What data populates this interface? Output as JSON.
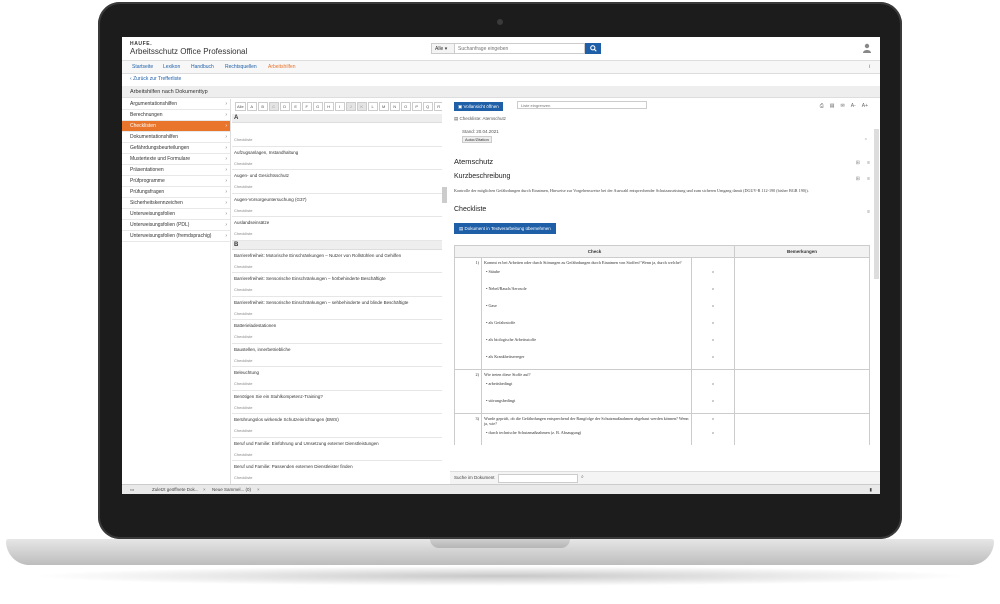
{
  "header": {
    "brand_small": "HAUFE.",
    "app_title": "Arbeitsschutz Office Professional",
    "search_scope": "Alle",
    "search_placeholder": "Suchanfrage eingeben",
    "user_icon": "user-icon"
  },
  "nav": {
    "tabs": [
      "Startseite",
      "Lexikon",
      "Handbuch",
      "Rechtsquellen",
      "Arbeitshilfen"
    ],
    "active": "Arbeitshilfen",
    "info": "i"
  },
  "back_link": "Zurück zur Trefferliste",
  "section_title": "Arbeitshilfen nach Dokumenttyp",
  "sidebar": {
    "items": [
      "Argumentationshilfen",
      "Berechnungen",
      "Checklisten",
      "Dokumentationshilfen",
      "Gefährdungsbeurteilungen",
      "Mustertexte und Formulare",
      "Präsentationen",
      "Prüfprogramme",
      "Prüfungsfragen",
      "Sicherheitskennzeichen",
      "Unterweisungsfolien",
      "Unterweisungsfolien (PDL)",
      "Unterweisungsfolien (fremdsprachig)"
    ],
    "active": "Checklisten"
  },
  "alphabet": {
    "all": "Alle",
    "letters": [
      "A",
      "B",
      "C",
      "D",
      "E",
      "F",
      "G",
      "H",
      "I",
      "J",
      "K",
      "L",
      "M",
      "N",
      "O",
      "P",
      "Q",
      "R",
      "S",
      "T",
      "U",
      "V",
      "W",
      "X",
      "Y",
      "Z"
    ],
    "disabled": [
      "C",
      "J",
      "K",
      "Y",
      "Z"
    ],
    "filter_placeholder": "Liste eingrenzen"
  },
  "list": {
    "group_a": "A",
    "entries_a": [
      {
        "title": "",
        "sub": "Checkliste"
      },
      {
        "title": "Aufzugsanlagen, Instandhaltung",
        "sub": "Checkliste"
      },
      {
        "title": "Augen- und Gesichtsschutz",
        "sub": "Checkliste"
      },
      {
        "title": "Augen-Vorsorgeuntersuchung (G37)",
        "sub": "Checkliste"
      },
      {
        "title": "Auslandseinsätze",
        "sub": "Checkliste"
      }
    ],
    "group_b": "B",
    "entries_b": [
      {
        "title": "Barrierefreiheit: Motorische Einschränkungen – Nutzer von Rollstühlen und Gehilfen",
        "sub": "Checkliste"
      },
      {
        "title": "Barrierefreiheit: Sensorische Einschränkungen – hörbehinderte Beschäftigte",
        "sub": "Checkliste"
      },
      {
        "title": "Barrierefreiheit: Sensorische Einschränkungen – sehbehinderte und blinde Beschäftigte",
        "sub": "Checkliste"
      },
      {
        "title": "Batterieladestationen",
        "sub": "Checkliste"
      },
      {
        "title": "Baustellen, innerbetriebliche",
        "sub": "Checkliste"
      },
      {
        "title": "Beleuchtung",
        "sub": "Checkliste"
      },
      {
        "title": "Benötigen Sie ein Stuhlkompetenz-Training?",
        "sub": "Checkliste"
      },
      {
        "title": "Berührungslos wirkende Schutzeinrichtungen (BWS)",
        "sub": "Checkliste"
      },
      {
        "title": "Beruf und Familie: Einführung und Umsetzung externer Dienstleistungen",
        "sub": "Checkliste"
      },
      {
        "title": "Beruf und Familie: Passenden externen Dienstleister finden",
        "sub": "Checkliste"
      },
      {
        "title": "Beruf und Familie: Vereinbarkeit im Unternehmen",
        "sub": ""
      }
    ]
  },
  "doc": {
    "full_view": "Vollansicht öffnen",
    "crumb": "Checkliste: Atemschutz",
    "stand": "Stand: 20.04.2021",
    "zitation": "Autor/Zitation",
    "title": "Atemschutz",
    "kurz_heading": "Kurzbeschreibung",
    "kurz_text": "Kontrolle der möglichen Gefährdungen durch Einatmen, Hinweise zur Vorgehensweise bei der Auswahl entsprechender Schutzausrüstung und zum sicheren Umgang damit (DGUV-R 112-190 (bisher BGR 190)).",
    "checkliste_heading": "Checkliste",
    "text_button": "Dokument in Textverarbeitung übernehmen",
    "table": {
      "col_check": "Check",
      "col_bem": "Bemerkungen",
      "rows": [
        {
          "num": "1)",
          "text": "Kommt es bei Arbeiten oder durch Störungen zu Gefährdungen durch Einatmen von Stoffen? Wenn ja, durch welche?",
          "box": "",
          "sub": [
            {
              "text": "• Stäube",
              "box": "o"
            },
            {
              "text": "• Nebel/Rauch/Aerosole",
              "box": "o"
            },
            {
              "text": "• Gase",
              "box": "o"
            },
            {
              "text": "• als Gefahrstoffe",
              "box": "o"
            },
            {
              "text": "• als biologische Arbeitsstoffe",
              "box": "o"
            },
            {
              "text": "• als Krankheitserreger",
              "box": "o"
            }
          ]
        },
        {
          "num": "2)",
          "text": "Wie treten diese Stoffe auf?",
          "box": "",
          "sub": [
            {
              "text": "• arbeitsbedingt",
              "box": "o"
            },
            {
              "text": "• störungsbedingt",
              "box": "o"
            }
          ]
        },
        {
          "num": "3)",
          "text": "Wurde geprüft, ob die Gefährdungen entsprechend der Rangfolge der Schutzmaßnahmen abgebaut werden können? Wenn ja, wie?",
          "box": "o",
          "sub": [
            {
              "text": "• durch technische Schutzmaßnahmen (z. B. Absaugung)",
              "box": "o"
            }
          ]
        }
      ]
    },
    "search_label": "Suche im Dokument",
    "tools": [
      "print-icon",
      "save-icon",
      "mail-icon",
      "font-decrease-icon",
      "font-increase-icon"
    ],
    "font_small": "A-",
    "font_large": "A+"
  },
  "footer": {
    "tabs": [
      "Zuletzt geöffnete Dok...",
      "Neue Sammel... (0)"
    ]
  }
}
